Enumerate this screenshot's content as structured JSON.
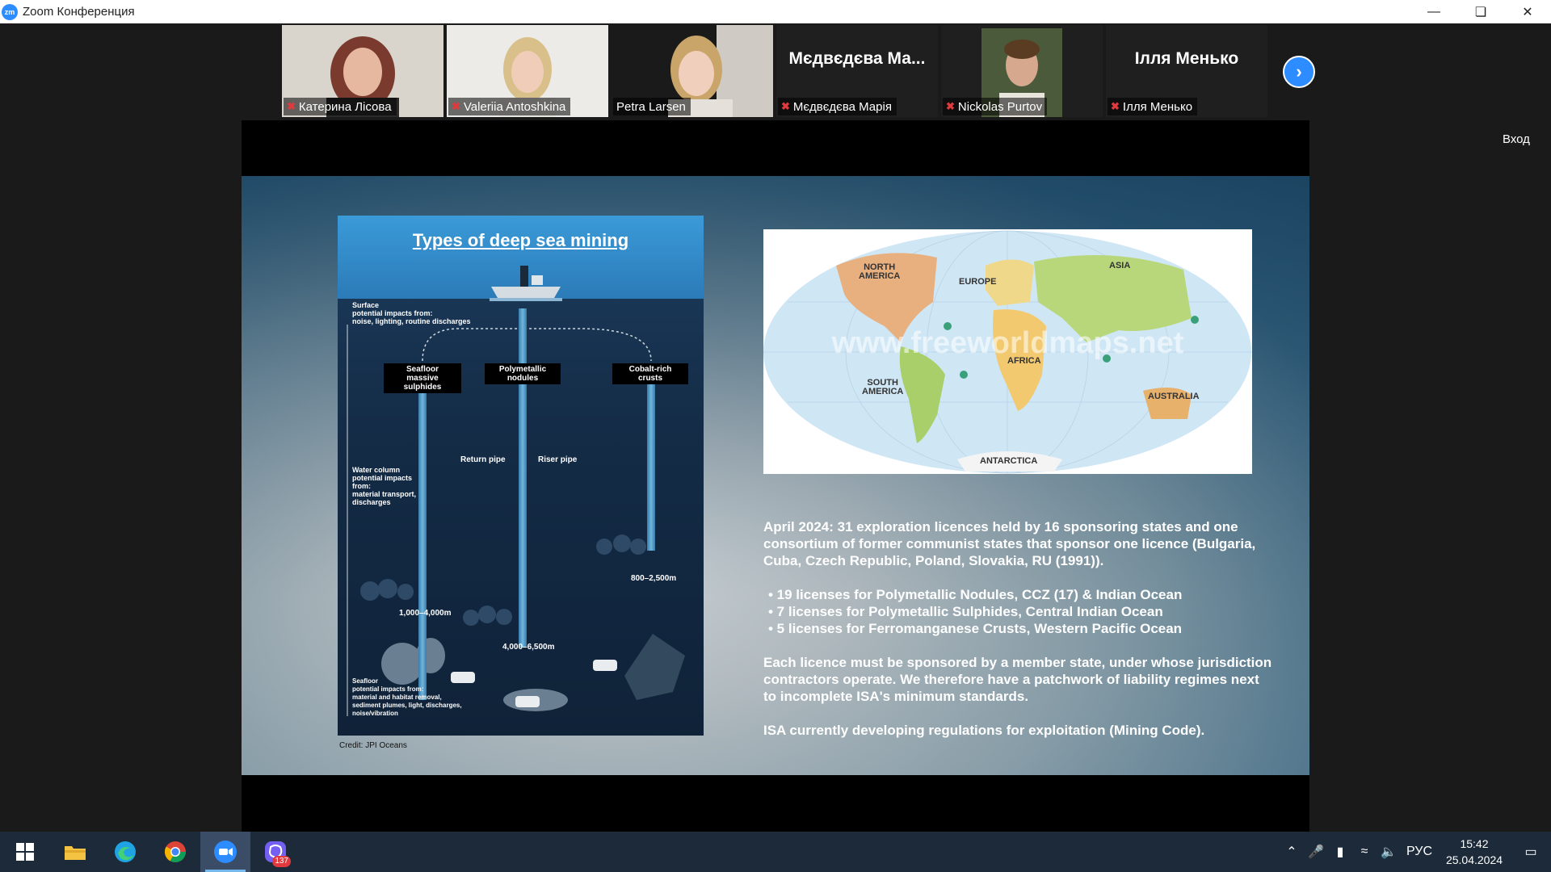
{
  "window": {
    "title": "Zoom Конференция",
    "app_icon_text": "zm"
  },
  "participants": [
    {
      "name": "Катерина Лісова",
      "video": true,
      "muted": true
    },
    {
      "name": "Valeriia Antoshkina",
      "video": true,
      "muted": true
    },
    {
      "name": "Petra Larsen",
      "video": true,
      "muted": false,
      "active_speaker": true
    },
    {
      "name": "Мєдвєдєва Марія",
      "display_name": "Мєдвєдєва Ма...",
      "video": false,
      "muted": true
    },
    {
      "name": "Nickolas Purtov",
      "video": true,
      "muted": true
    },
    {
      "name": "Ілля Менько",
      "display_name": "Ілля Менько",
      "video": false,
      "muted": true
    }
  ],
  "sign_in_label": "Вход",
  "infographic": {
    "title": "Types of deep sea mining",
    "surface_note": "Surface\npotential impacts from:\nnoise, lighting, routine discharges",
    "pipes": [
      "Seafloor\nmassive sulphides",
      "Polymetallic\nnodules",
      "Cobalt-rich\ncrusts"
    ],
    "return_pipe": "Return pipe",
    "riser_pipe": "Riser pipe",
    "water_column_note": "Water column\npotential impacts\nfrom:\nmaterial transport,\ndischarges",
    "depths": [
      "1,000–4,000m",
      "4,000–6,500m",
      "800–2,500m"
    ],
    "seafloor_note": "Seafloor\npotential impacts from:\nmaterial and habitat removal,\nsediment plumes, light, discharges,\nnoise/vibration",
    "credit": "Credit: JPI Oceans"
  },
  "map": {
    "labels": [
      "NORTH\nAMERICA",
      "EUROPE",
      "ASIA",
      "AFRICA",
      "SOUTH\nAMERICA",
      "AUSTRALIA",
      "ANTARCTICA"
    ],
    "watermark": "www.freeworldmaps.net"
  },
  "slide_text": {
    "intro": "April 2024: 31 exploration licences held by 16 sponsoring states and one consortium of former communist states that sponsor one licence (Bulgaria, Cuba, Czech Republic, Poland, Slovakia, RU (1991)).",
    "bullets": [
      "• 19 licenses for Polymetallic Nodules, CCZ (17) & Indian Ocean",
      "• 7 licenses for Polymetallic Sulphides, Central Indian Ocean",
      "• 5 licenses for Ferromanganese Crusts, Western Pacific Ocean"
    ],
    "sponsorship": "Each licence must be sponsored by a member state, under whose jurisdiction contractors operate. We therefore have a patchwork of liability regimes next to incomplete ISA's minimum standards.",
    "mining_code": "ISA currently developing regulations for exploitation (Mining Code)."
  },
  "taskbar": {
    "apps": [
      "start",
      "file-explorer",
      "edge",
      "chrome",
      "zoom",
      "viber"
    ],
    "viber_badge": "137",
    "language": "РУС",
    "time": "15:42",
    "date": "25.04.2024"
  },
  "colors": {
    "zoom_blue": "#2D8CFF",
    "mic_off": "#e0393e",
    "active_outline": "#b4c86a"
  }
}
